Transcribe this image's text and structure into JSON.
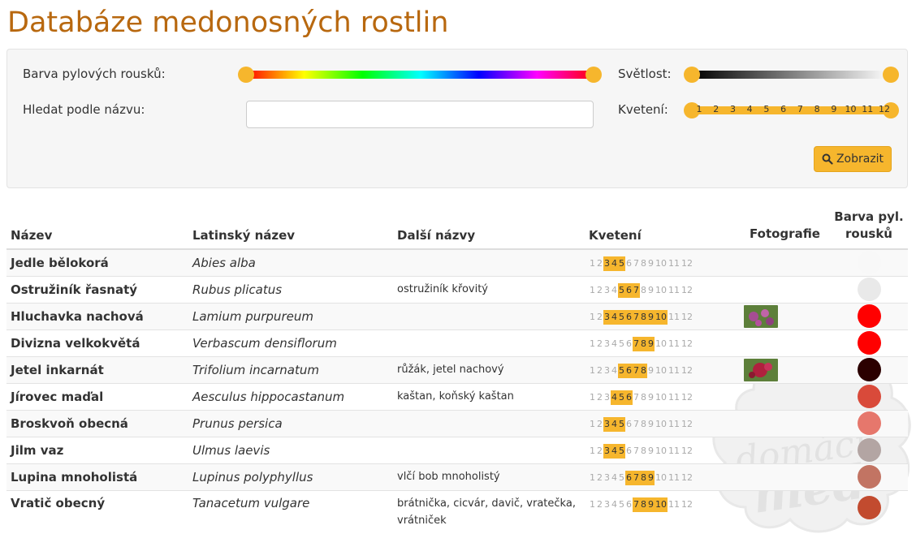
{
  "page": {
    "title": "Databáze medonosných rostlin"
  },
  "filters": {
    "pollen_color_label": "Barva pylových rousků:",
    "lightness_label": "Světlost:",
    "search_label": "Hledat podle názvu:",
    "search_value": "",
    "search_placeholder": "",
    "bloom_label": "Kvetení:",
    "bloom_range": [
      1,
      12
    ],
    "bloom_ticks": [
      "1",
      "2",
      "3",
      "4",
      "5",
      "6",
      "7",
      "8",
      "9",
      "10",
      "11",
      "12"
    ],
    "hue_range": [
      0,
      1
    ],
    "lightness_range": [
      0,
      1
    ],
    "show_button_label": "Zobrazit",
    "show_button_icon": "search-icon",
    "accent_color": "#f6b62d"
  },
  "table": {
    "columns": [
      "Název",
      "Latinský název",
      "Další názvy",
      "Kvetení",
      "Fotografie",
      "Barva pyl. rousků"
    ],
    "month_labels": [
      "1",
      "2",
      "3",
      "4",
      "5",
      "6",
      "7",
      "8",
      "9",
      "10",
      "11",
      "12"
    ],
    "rows": [
      {
        "name": "Jedle bělokorá",
        "latin": "Abies alba",
        "other": "",
        "bloom": [
          3,
          4,
          5
        ],
        "photo": false,
        "color": "#f8f8f8"
      },
      {
        "name": "Ostružiník řasnatý",
        "latin": "Rubus plicatus",
        "other": "ostružiník křovitý",
        "bloom": [
          5,
          6,
          7
        ],
        "photo": false,
        "color": "#e9e9e9"
      },
      {
        "name": "Hluchavka nachová",
        "latin": "Lamium purpureum",
        "other": "",
        "bloom": [
          3,
          4,
          5,
          6,
          7,
          8,
          9,
          10
        ],
        "photo": true,
        "color": "#ff0000"
      },
      {
        "name": "Divizna velkokvětá",
        "latin": "Verbascum densiflorum",
        "other": "",
        "bloom": [
          7,
          8,
          9
        ],
        "photo": false,
        "color": "#ff0000"
      },
      {
        "name": "Jetel inkarnát",
        "latin": "Trifolium incarnatum",
        "other": "růžák, jetel nachový",
        "bloom": [
          5,
          6,
          7,
          8
        ],
        "photo": true,
        "color": "#2b0000"
      },
      {
        "name": "Jírovec maďal",
        "latin": "Aesculus hippocastanum",
        "other": "kaštan, koňský kaštan",
        "bloom": [
          4,
          5,
          6
        ],
        "photo": false,
        "color": "#d94a3a"
      },
      {
        "name": "Broskvoň obecná",
        "latin": "Prunus persica",
        "other": "",
        "bloom": [
          3,
          4,
          5
        ],
        "photo": false,
        "color": "#e6776c"
      },
      {
        "name": "Jilm vaz",
        "latin": "Ulmus laevis",
        "other": "",
        "bloom": [
          3,
          4,
          5
        ],
        "photo": false,
        "color": "#b3a5a3"
      },
      {
        "name": "Lupina mnoholistá",
        "latin": "Lupinus polyphyllus",
        "other": "vlčí bob mnoholistý",
        "bloom": [
          6,
          7,
          8,
          9
        ],
        "photo": false,
        "color": "#c27463"
      },
      {
        "name": "Vratič obecný",
        "latin": "Tanacetum vulgare",
        "other": "brátnička, cicvár, davič, vratečka, vrátniček",
        "bloom": [
          7,
          8,
          9,
          10
        ],
        "photo": false,
        "color": "#c24b2f"
      }
    ]
  },
  "watermark": {
    "text_line1": "domácí",
    "text_line2": "med"
  }
}
